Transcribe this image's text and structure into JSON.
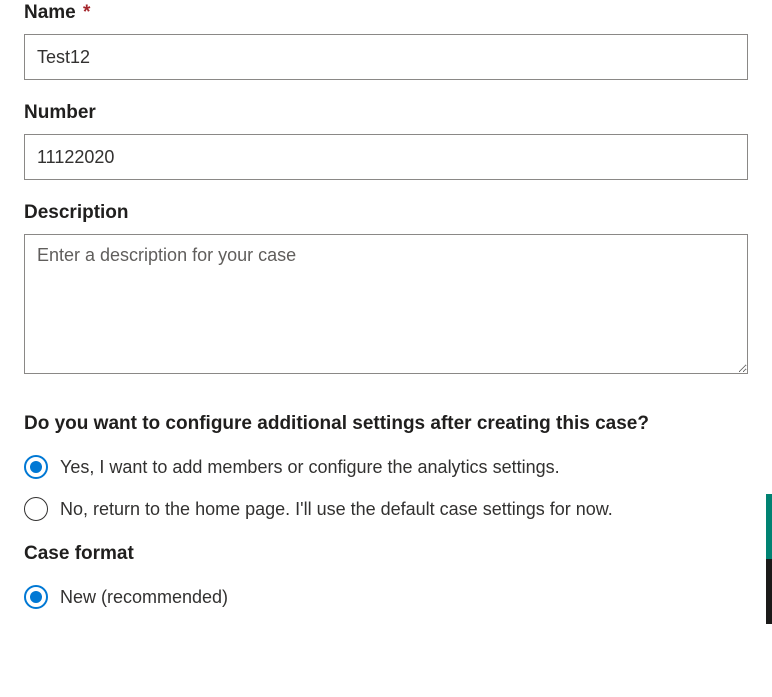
{
  "name": {
    "label": "Name",
    "required": "*",
    "value": "Test12"
  },
  "number": {
    "label": "Number",
    "value": "11122020"
  },
  "description": {
    "label": "Description",
    "placeholder": "Enter a description for your case",
    "value": ""
  },
  "configure": {
    "question": "Do you want to configure additional settings after creating this case?",
    "options": {
      "yes": "Yes, I want to add members or configure the analytics settings.",
      "no": "No, return to the home page. I'll use the default case settings for now."
    },
    "selected": "yes"
  },
  "format": {
    "label": "Case format",
    "options": {
      "new": "New (recommended)"
    },
    "selected": "new"
  }
}
